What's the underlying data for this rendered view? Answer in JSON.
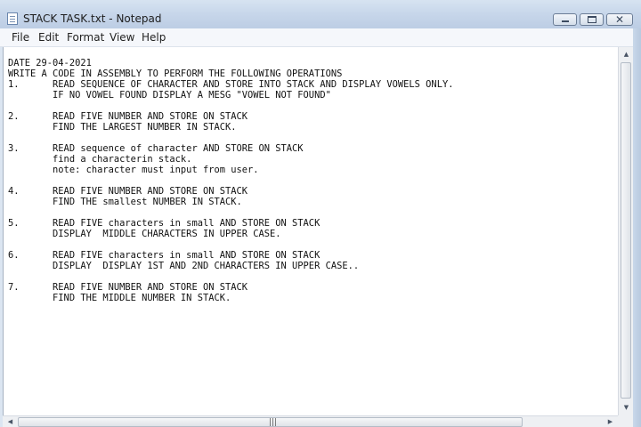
{
  "window": {
    "title": "STACK TASK.txt - Notepad"
  },
  "menu": [
    "File",
    "Edit",
    "Format",
    "View",
    "Help"
  ],
  "caption_buttons": {
    "close": "✕"
  },
  "document": {
    "lines": [
      "DATE 29-04-2021",
      "WRITE A CODE IN ASSEMBLY TO PERFORM THE FOLLOWING OPERATIONS",
      "1.      READ SEQUENCE OF CHARACTER AND STORE INTO STACK AND DISPLAY VOWELS ONLY.",
      "        IF NO VOWEL FOUND DISPLAY A MESG \"VOWEL NOT FOUND\"",
      "",
      "2.      READ FIVE NUMBER AND STORE ON STACK",
      "        FIND THE LARGEST NUMBER IN STACK.",
      "",
      "3.      READ sequence of character AND STORE ON STACK",
      "        find a characterin stack.",
      "        note: character must input from user.",
      "",
      "4.      READ FIVE NUMBER AND STORE ON STACK",
      "        FIND THE smallest NUMBER IN STACK.",
      "",
      "5.      READ FIVE characters in small AND STORE ON STACK",
      "        DISPLAY  MIDDLE CHARACTERS IN UPPER CASE.",
      "",
      "6.      READ FIVE characters in small AND STORE ON STACK",
      "        DISPLAY  DISPLAY 1ST AND 2ND CHARACTERS IN UPPER CASE..",
      "",
      "7.      READ FIVE NUMBER AND STORE ON STACK",
      "        FIND THE MIDDLE NUMBER IN STACK."
    ]
  },
  "scrollbars": {
    "up": "▲",
    "down": "▼",
    "left": "◀",
    "right": "▶",
    "grip": "|||"
  }
}
